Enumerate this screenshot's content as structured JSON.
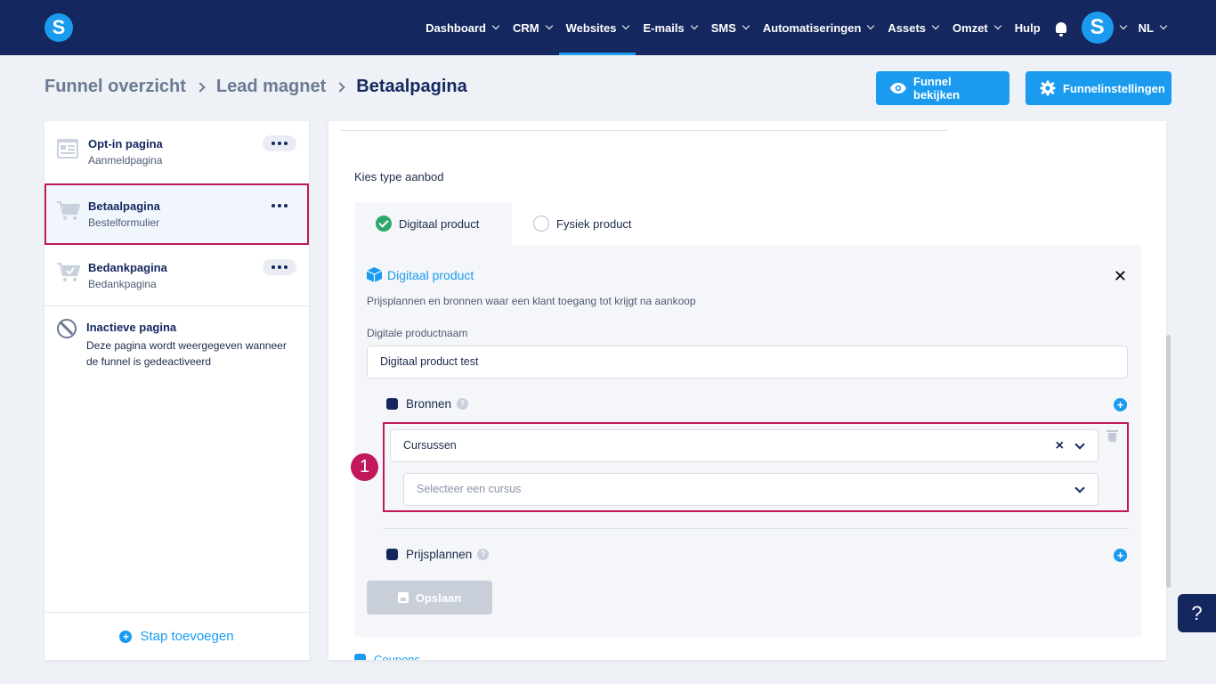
{
  "app": {
    "logo_letter": "S",
    "avatar_letter": "S"
  },
  "nav": {
    "items": [
      {
        "label": "Dashboard",
        "has_dropdown": true,
        "active": false
      },
      {
        "label": "CRM",
        "has_dropdown": true,
        "active": false
      },
      {
        "label": "Websites",
        "has_dropdown": true,
        "active": true
      },
      {
        "label": "E-mails",
        "has_dropdown": true,
        "active": false
      },
      {
        "label": "SMS",
        "has_dropdown": true,
        "active": false
      },
      {
        "label": "Automatiseringen",
        "has_dropdown": true,
        "active": false
      },
      {
        "label": "Assets",
        "has_dropdown": true,
        "active": false
      },
      {
        "label": "Omzet",
        "has_dropdown": true,
        "active": false
      },
      {
        "label": "Hulp",
        "has_dropdown": false,
        "active": false
      }
    ],
    "language": "NL"
  },
  "breadcrumb": [
    "Funnel overzicht",
    "Lead magnet",
    "Betaalpagina"
  ],
  "header_buttons": {
    "view": "Funnel bekijken",
    "settings": "Funnelinstellingen"
  },
  "sidebar": {
    "steps": [
      {
        "title": "Opt-in pagina",
        "subtitle": "Aanmeldpagina",
        "icon": "form-page-icon",
        "selected": false
      },
      {
        "title": "Betaalpagina",
        "subtitle": "Bestelformulier",
        "icon": "cart-icon",
        "selected": true
      },
      {
        "title": "Bedankpagina",
        "subtitle": "Bedankpagina",
        "icon": "cart-check-icon",
        "selected": false
      }
    ],
    "inactive": {
      "title": "Inactieve pagina",
      "description": "Deze pagina wordt weergegeven wanneer de funnel is gedeactiveerd"
    },
    "add_step": "Stap toevoegen"
  },
  "main": {
    "offer_type_label": "Kies type aanbod",
    "tabs": [
      {
        "label": "Digitaal product",
        "selected": true
      },
      {
        "label": "Fysiek product",
        "selected": false
      }
    ],
    "product": {
      "title": "Digitaal product",
      "description": "Prijsplannen en bronnen waar een klant toegang tot krijgt na aankoop",
      "name_label": "Digitale productnaam",
      "name_value": "Digitaal product test",
      "bronnen_label": "Bronnen",
      "source_type_value": "Cursussen",
      "course_placeholder": "Selecteer een cursus",
      "prijsplannen_label": "Prijsplannen",
      "save_label": "Opslaan"
    },
    "coupons_label": "Coupons"
  },
  "annotation": {
    "number": "1"
  },
  "help_fab": "?",
  "colors": {
    "nav_bg": "#14275e",
    "accent": "#1a9bf0",
    "highlight": "#c2185b",
    "success": "#2ca86b"
  }
}
